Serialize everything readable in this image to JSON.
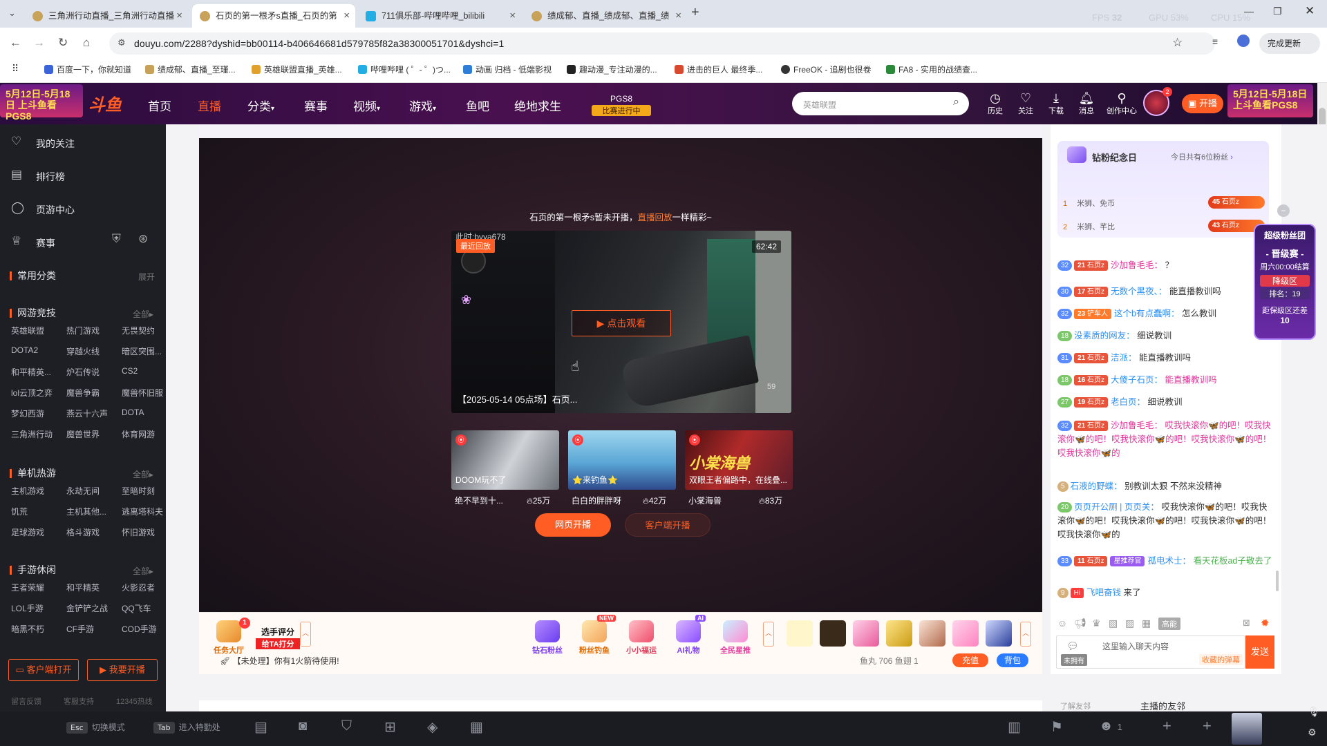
{
  "browser": {
    "tabs": [
      {
        "title": "三角洲行动直播_三角洲行动直播"
      },
      {
        "title": "石页的第一根矛s直播_石页的第"
      },
      {
        "title": "711俱乐部-哔哩哔哩_bilibili"
      },
      {
        "title": "绩成郁、直播_绩成郁、直播_绩"
      }
    ],
    "hud": {
      "fps_label": "FPS",
      "fps_value": "32",
      "gpu": "GPU 53%",
      "cpu": "CPU 15%"
    },
    "url": "douyu.com/2288?dyshid=bb00114-b406646681d579785f82a38300051701&dyshci=1",
    "finish_update": "完成更新",
    "bookmarks": [
      "百度一下，你就知道",
      "绩成郁、直播_至瑾...",
      "英雄联盟直播_英雄...",
      "哔哩哔哩 ( ゜- ゜)つ...",
      "动画 归档 - 低端影视",
      "趣动漫_专注动漫的...",
      "进击的巨人 最终季...",
      "FreeOK - 追剧也很卷",
      "FA8 - 实用的战绩查..."
    ]
  },
  "site": {
    "banner_left": "5月12日-5月18日 上斗鱼看PGS8",
    "banner_right": "5月12日-5月18日 上斗鱼看PGS8",
    "logo": "斗鱼",
    "nav": [
      "首页",
      "直播",
      "分类",
      "赛事",
      "视频",
      "游戏",
      "鱼吧",
      "绝地求生"
    ],
    "pgs": {
      "line1": "PGS8",
      "line2": "比赛进行中"
    },
    "search_placeholder": "英雄联盟",
    "icons": [
      "历史",
      "关注",
      "下载",
      "消息",
      "创作中心"
    ],
    "avatar_badge": "2",
    "kaibo": "开播"
  },
  "sidebar": {
    "main": [
      "我的关注",
      "排行榜",
      "页游中心",
      "赛事"
    ],
    "common": {
      "title": "常用分类",
      "action": "展开"
    },
    "sections": [
      {
        "title": "网游竞技",
        "action": "全部",
        "items": [
          "英雄联盟",
          "热门游戏",
          "无畏契约",
          "DOTA2",
          "穿越火线",
          "暗区突围...",
          "和平精英...",
          "炉石传说",
          "CS2",
          "lol云顶之弈",
          "魔兽争霸",
          "魔兽怀旧服",
          "梦幻西游",
          "燕云十六声",
          "DOTA",
          "三角洲行动",
          "魔兽世界",
          "体育网游"
        ]
      },
      {
        "title": "单机热游",
        "action": "全部",
        "items": [
          "主机游戏",
          "永劫无间",
          "至暗时刻",
          "饥荒",
          "主机其他...",
          "逃离塔科夫",
          "足球游戏",
          "格斗游戏",
          "怀旧游戏"
        ]
      },
      {
        "title": "手游休闲",
        "action": "全部",
        "items": [
          "王者荣耀",
          "和平精英",
          "火影忍者",
          "LOL手游",
          "金铲铲之战",
          "QQ飞车",
          "暗黑不朽",
          "CF手游",
          "COD手游"
        ]
      }
    ],
    "btn_client": "客户端打开",
    "btn_kaibo": "我要开播",
    "footer": [
      "留言反馈",
      "客服支持",
      "12345热线"
    ]
  },
  "player": {
    "offline_text": "石页的第一根矛s暂未开播，",
    "offline_link": "直播回放",
    "offline_tail": "一样精彩~",
    "watermark": "此时:bvya678",
    "badge": "最近回放",
    "duration": "62:42",
    "watch": "点击观看",
    "caption": "【2025-05-14 05点场】石页...",
    "counter": "59",
    "recs": [
      {
        "overlay": "DOOM玩不了",
        "name": "绝不早到十...",
        "heat": "25万"
      },
      {
        "overlay": "⭐来钓鱼⭐",
        "name": "白白的胖胖呀",
        "heat": "42万"
      },
      {
        "overlay": "双眼王者偏路中，在线叠...",
        "name": "小棠海兽",
        "heat": "83万"
      }
    ],
    "btn_web": "网页开播",
    "btn_client": "客户端开播"
  },
  "giftbar": {
    "task": "任务大厅",
    "task_badge": "1",
    "rate": "选手评分",
    "rate_sub": "给TA打分",
    "gifts": [
      "钻石粉丝",
      "粉丝钓鱼",
      "小小福运",
      "AI礼物",
      "全民星推"
    ],
    "new_tag": "NEW",
    "ai_tag": "AI",
    "notice": "【未处理】你有1火箭待使用!",
    "wallet": "鱼丸 706   鱼翅 1",
    "recharge": "充值",
    "pack": "背包"
  },
  "chat": {
    "fan_title": "钻粉纪念日",
    "fan_today": "今日共有6位粉丝",
    "fan_rows": [
      {
        "rank": "1",
        "name": "米狮、免币",
        "lv": "45",
        "badge": "石页z"
      },
      {
        "rank": "2",
        "name": "米狮、芊比",
        "lv": "43",
        "badge": "石页z"
      }
    ],
    "messages": [
      {
        "lv": "32",
        "fl": "21",
        "fb": "石页z",
        "user": "沙加鲁毛毛：",
        "text": "？"
      },
      {
        "lv": "30",
        "fl": "17",
        "fb": "石页z",
        "user": "无数个黑夜、：",
        "text": "能直播教训吗"
      },
      {
        "lv": "32",
        "fl": "23",
        "fb": "铲车人",
        "user": "这个b有点蠢啊：",
        "text": "怎么教训"
      },
      {
        "lv": "18",
        "user": "没素质的网友：",
        "text": "细说教训"
      },
      {
        "lv": "31",
        "fl": "21",
        "fb": "石页z",
        "user": "洁派：",
        "text": "能直播教训吗"
      },
      {
        "lv": "18",
        "fl": "16",
        "fb": "石页z",
        "user": "大傻子石页：",
        "text": "能直播教训吗"
      },
      {
        "lv": "27",
        "fl": "19",
        "fb": "石页z",
        "user": "老白页：",
        "text": "细说教训"
      },
      {
        "lv": "32",
        "fl": "21",
        "fb": "石页z",
        "user": "沙加鲁毛毛：",
        "text": "哎我快滚你🦋的吧！哎我快滚你🦋的吧！哎我快滚你🦋的吧！哎我快滚你🦋的吧！哎我快滚你🦋的"
      },
      {
        "lv": "5",
        "user": "石液的野蝶：",
        "text": "别教训太狠 不然来没精神"
      },
      {
        "lv": "20",
        "user": "页页开公厕 | 页页关：",
        "text": "哎我快滚你🦋的吧！哎我快滚你🦋的吧！哎我快滚你🦋的吧！哎我快滚你🦋的吧！哎我快滚你🦋的"
      },
      {
        "lv": "33",
        "fl": "11",
        "fb": "石页z",
        "tag": "星推荐官",
        "user": "孤电术士：",
        "text": "看天花板ad子敬去了"
      },
      {
        "lv": "9",
        "hi": "Hi",
        "user": "飞吧奋钱",
        "text": "来了"
      }
    ],
    "input_placeholder": "这里输入聊天内容",
    "input_tip": "收藏的弹幕",
    "unused": "未拥有",
    "send": "发送",
    "tools_label": "高能",
    "friends_label": "了解友邻",
    "friends_title": "主播的友邻"
  },
  "superfan": {
    "title": "超级粉丝团",
    "sub": "- 晋级赛 -",
    "time": "周六00:00结算",
    "zone": "降级区",
    "rank": "排名：19",
    "away": "距保级区还差",
    "value": "10"
  },
  "bottombar": {
    "esc": "Esc",
    "esc_label": "切换模式",
    "tab": "Tab",
    "tab_label": "进入特勤处",
    "players": "1"
  }
}
